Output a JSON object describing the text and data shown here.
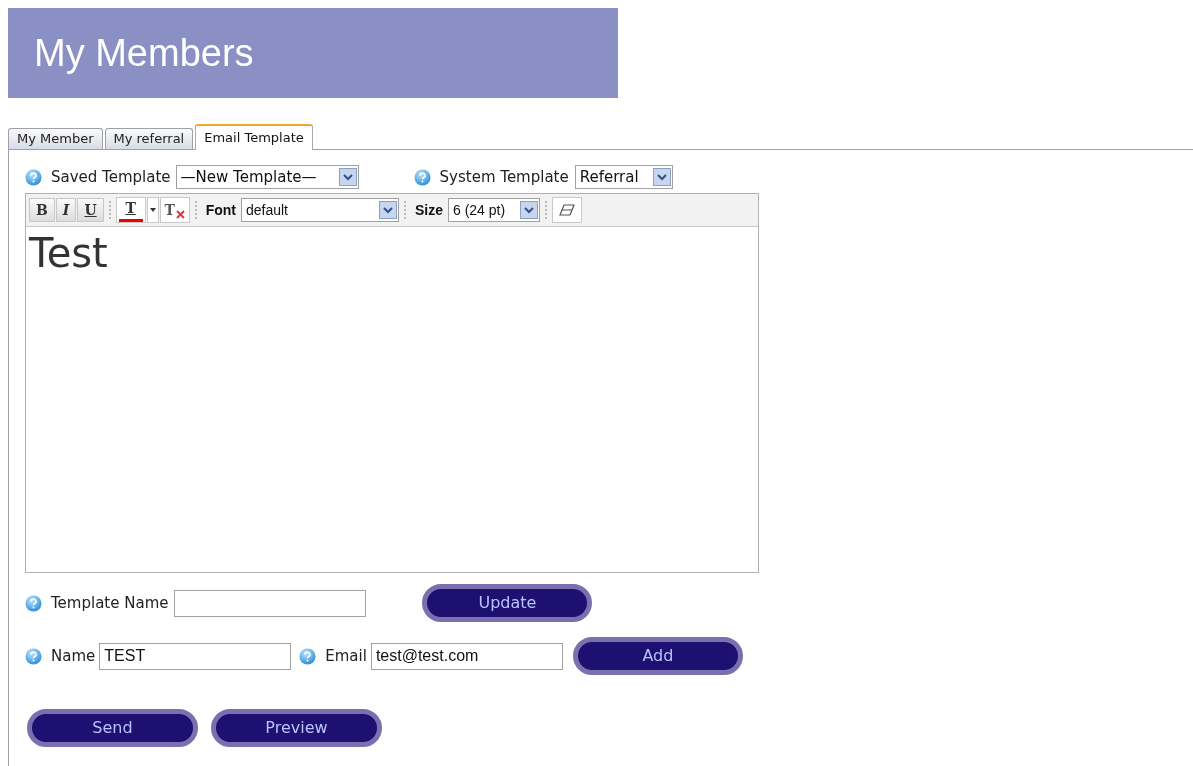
{
  "header": {
    "title": "My Members"
  },
  "tabs": [
    {
      "label": "My Member",
      "selected": false
    },
    {
      "label": "My referral",
      "selected": false
    },
    {
      "label": "Email Template",
      "selected": true
    }
  ],
  "saved_template": {
    "label": "Saved Template",
    "value": "—New Template—"
  },
  "system_template": {
    "label": "System Template",
    "value": "Referral"
  },
  "toolbar": {
    "format_buttons": [
      {
        "label": "B",
        "kind": "bold"
      },
      {
        "label": "I",
        "kind": "italic"
      },
      {
        "label": "U",
        "kind": "underline"
      }
    ],
    "text_color": {
      "label": "T",
      "color": "#ee0000"
    },
    "remove_format": {
      "label": "T"
    },
    "font": {
      "label": "Font",
      "value": "default"
    },
    "size": {
      "label": "Size",
      "value": "6 (24 pt)"
    }
  },
  "editor": {
    "content": "Test"
  },
  "template_name": {
    "label": "Template Name",
    "button": "Update"
  },
  "name": {
    "label": "Name",
    "value": "TEST"
  },
  "email": {
    "label": "Email",
    "value": "test@test.com",
    "button": "Add"
  },
  "actions": [
    "Send",
    "Preview"
  ]
}
